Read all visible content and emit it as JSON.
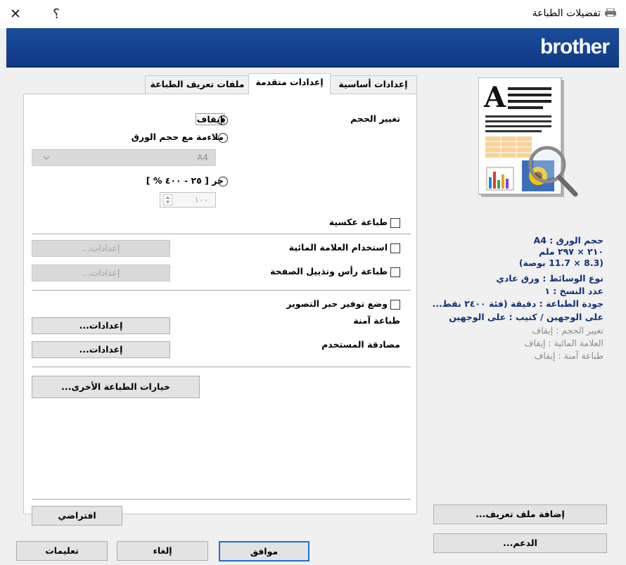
{
  "window": {
    "title": "تفضيلات الطباعة",
    "close_glyph": "✕",
    "help_glyph": "؟",
    "brand_logo": "brother"
  },
  "tabs": [
    {
      "label": "إعدادات أساسية"
    },
    {
      "label": "إعدادات متقدمة"
    },
    {
      "label": "ملفات تعريف الطباعة"
    }
  ],
  "scaling": {
    "label": "تغيير الحجم",
    "options": [
      {
        "label": "إيقاف",
        "checked": true
      },
      {
        "label": "ملاءمة مع حجم الورق",
        "checked": false
      },
      {
        "label": "حر [ ٢٥ - ٤٠٠ % ]",
        "checked": false
      }
    ],
    "paper_size_value": "A4",
    "free_value": "١٠٠"
  },
  "options": {
    "reverse_print": "طباعة عكسية",
    "watermark": "استخدام العلامة المائية",
    "header_footer": "طباعة رأس وتذييل الصفحة",
    "toner_save": "وضع توفير حبر التصوير",
    "secure_print": "طباعة آمنة",
    "user_auth": "مصادقة المستخدم"
  },
  "buttons": {
    "settings_label": "إعدادات...",
    "other_print_options": "خيارات الطباعة الأخرى...",
    "default": "افتراضي",
    "add_profile": "إضافة ملف تعريف...",
    "support": "الدعم...",
    "ok": "موافق",
    "cancel": "إلغاء",
    "help": "تعليمات"
  },
  "summary": {
    "paper_size": "حجم الورق : A4",
    "paper_dim_mm": "٢١٠ × ٢٩٧ ملم",
    "paper_dim_in": "(8.3 × 11.7 بوصة)",
    "media_type": "نوع الوسائط : ورق عادي",
    "copies": "عدد النسخ : ١",
    "print_quality": "جودة الطباعة : دقيقة (فئة ٢٤٠٠ نقط...",
    "duplex": "على الوجهين / كتيب : على الوجهين",
    "scaling": "تغيير الحجم : إيقاف",
    "watermark": "العلامة المائية : إيقاف",
    "secure_print": "طباعة آمنة : إيقاف"
  },
  "colors": {
    "brand_bar": "#1a4896",
    "summary_bold": "#10327a",
    "primary_border": "#1f6fd1"
  }
}
